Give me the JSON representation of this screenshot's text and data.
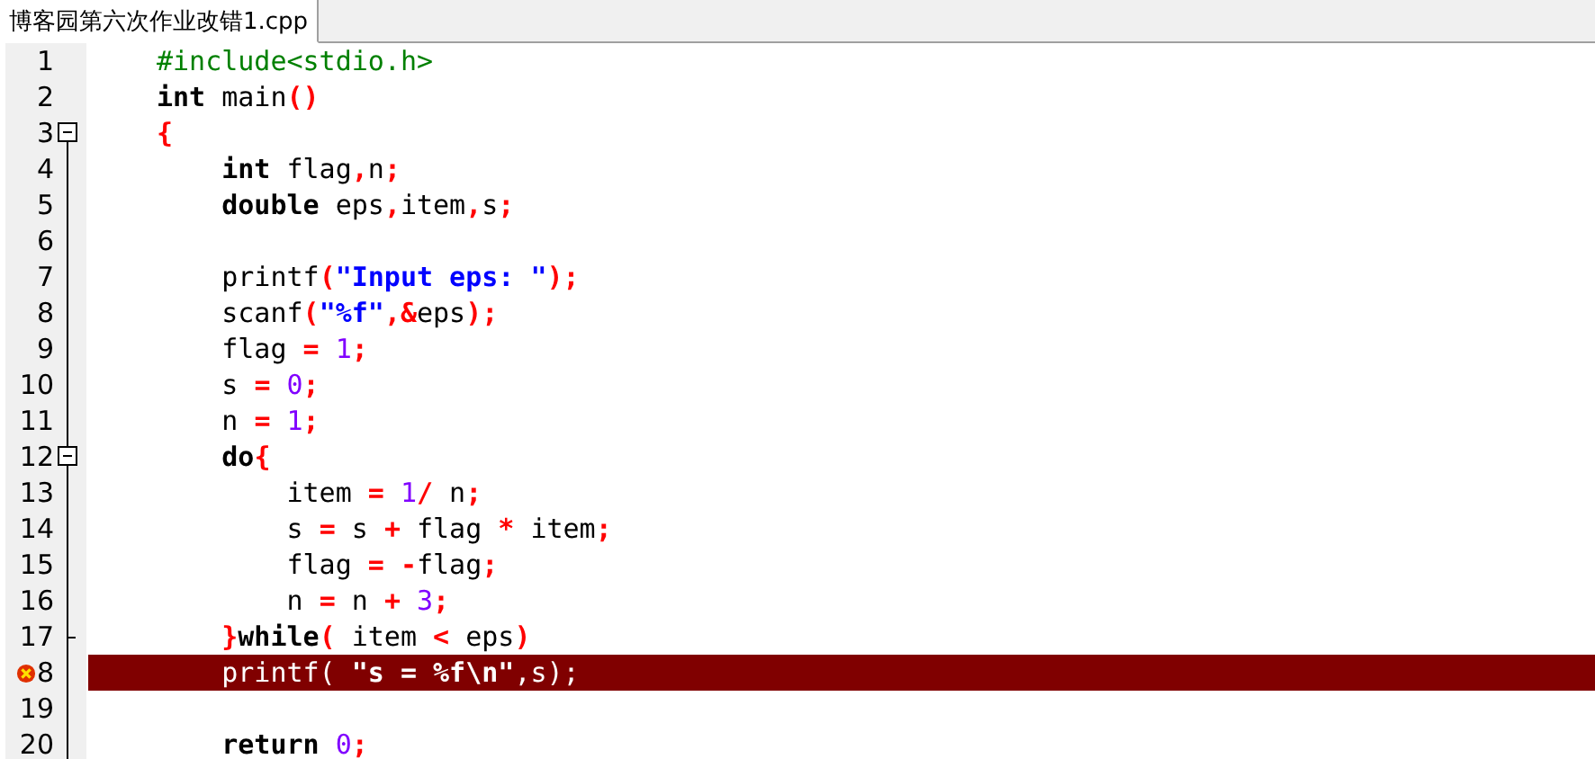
{
  "tabs": [
    {
      "label": "博客园第六次作业改错1.cpp",
      "selected": true
    }
  ],
  "lines": [
    {
      "number": "1",
      "tokens": [
        {
          "text": "#include<stdio.h>",
          "kind": "preproc"
        }
      ]
    },
    {
      "number": "2",
      "tokens": [
        {
          "text": "int",
          "kind": "keyword"
        },
        {
          "text": " main",
          "kind": "plain"
        },
        {
          "text": "()",
          "kind": "symbol"
        }
      ]
    },
    {
      "number": "3",
      "fold_start": true,
      "expanded": true,
      "tokens": [
        {
          "text": "{",
          "kind": "symbol"
        }
      ]
    },
    {
      "number": "4",
      "tokens": [
        {
          "text": "    int",
          "kind": "keyword"
        },
        {
          "text": " flag",
          "kind": "plain"
        },
        {
          "text": ",",
          "kind": "symbol"
        },
        {
          "text": "n",
          "kind": "plain"
        },
        {
          "text": ";",
          "kind": "symbol"
        }
      ]
    },
    {
      "number": "5",
      "tokens": [
        {
          "text": "    double",
          "kind": "keyword"
        },
        {
          "text": " eps",
          "kind": "plain"
        },
        {
          "text": ",",
          "kind": "symbol"
        },
        {
          "text": "item",
          "kind": "plain"
        },
        {
          "text": ",",
          "kind": "symbol"
        },
        {
          "text": "s",
          "kind": "plain"
        },
        {
          "text": ";",
          "kind": "symbol"
        }
      ]
    },
    {
      "number": "6"
    },
    {
      "number": "7",
      "tokens": [
        {
          "text": "    printf",
          "kind": "plain"
        },
        {
          "text": "(",
          "kind": "symbol"
        },
        {
          "text": "\"Input eps: \"",
          "kind": "string"
        },
        {
          "text": ");",
          "kind": "symbol"
        }
      ]
    },
    {
      "number": "8",
      "tokens": [
        {
          "text": "    scanf",
          "kind": "plain"
        },
        {
          "text": "(",
          "kind": "symbol"
        },
        {
          "text": "\"%f\"",
          "kind": "string"
        },
        {
          "text": ",&",
          "kind": "symbol"
        },
        {
          "text": "eps",
          "kind": "plain"
        },
        {
          "text": ");",
          "kind": "symbol"
        }
      ]
    },
    {
      "number": "9",
      "tokens": [
        {
          "text": "    flag ",
          "kind": "plain"
        },
        {
          "text": "=",
          "kind": "symbol"
        },
        {
          "text": " 1",
          "kind": "number"
        },
        {
          "text": ";",
          "kind": "symbol"
        }
      ]
    },
    {
      "number": "10",
      "tokens": [
        {
          "text": "    s ",
          "kind": "plain"
        },
        {
          "text": "=",
          "kind": "symbol"
        },
        {
          "text": " 0",
          "kind": "number"
        },
        {
          "text": ";",
          "kind": "symbol"
        }
      ]
    },
    {
      "number": "11",
      "tokens": [
        {
          "text": "    n ",
          "kind": "plain"
        },
        {
          "text": "=",
          "kind": "symbol"
        },
        {
          "text": " 1",
          "kind": "number"
        },
        {
          "text": ";",
          "kind": "symbol"
        }
      ]
    },
    {
      "number": "12",
      "fold_start": true,
      "expanded": true,
      "tokens": [
        {
          "text": "    do",
          "kind": "keyword"
        },
        {
          "text": "{",
          "kind": "symbol"
        }
      ]
    },
    {
      "number": "13",
      "tokens": [
        {
          "text": "        item ",
          "kind": "plain"
        },
        {
          "text": "=",
          "kind": "symbol"
        },
        {
          "text": " 1",
          "kind": "number"
        },
        {
          "text": "/",
          "kind": "symbol"
        },
        {
          "text": " n",
          "kind": "plain"
        },
        {
          "text": ";",
          "kind": "symbol"
        }
      ]
    },
    {
      "number": "14",
      "tokens": [
        {
          "text": "        s ",
          "kind": "plain"
        },
        {
          "text": "=",
          "kind": "symbol"
        },
        {
          "text": " s ",
          "kind": "plain"
        },
        {
          "text": "+",
          "kind": "symbol"
        },
        {
          "text": " flag ",
          "kind": "plain"
        },
        {
          "text": "*",
          "kind": "symbol"
        },
        {
          "text": " item",
          "kind": "plain"
        },
        {
          "text": ";",
          "kind": "symbol"
        }
      ]
    },
    {
      "number": "15",
      "tokens": [
        {
          "text": "        flag ",
          "kind": "plain"
        },
        {
          "text": "=",
          "kind": "symbol"
        },
        {
          "text": " -",
          "kind": "symbol"
        },
        {
          "text": "flag",
          "kind": "plain"
        },
        {
          "text": ";",
          "kind": "symbol"
        }
      ]
    },
    {
      "number": "16",
      "tokens": [
        {
          "text": "        n ",
          "kind": "plain"
        },
        {
          "text": "=",
          "kind": "symbol"
        },
        {
          "text": " n ",
          "kind": "plain"
        },
        {
          "text": "+",
          "kind": "symbol"
        },
        {
          "text": " 3",
          "kind": "number"
        },
        {
          "text": ";",
          "kind": "symbol"
        }
      ]
    },
    {
      "number": "17",
      "fold_end": true,
      "tokens": [
        {
          "text": "    }",
          "kind": "symbol"
        },
        {
          "text": "while",
          "kind": "keyword"
        },
        {
          "text": "(",
          "kind": "symbol"
        },
        {
          "text": " item ",
          "kind": "plain"
        },
        {
          "text": "<",
          "kind": "symbol"
        },
        {
          "text": " eps",
          "kind": "plain"
        },
        {
          "text": ")",
          "kind": "symbol"
        }
      ]
    },
    {
      "number": "8",
      "breakpoint": true,
      "highlighted": true,
      "tokens": [
        {
          "text": "    printf( ",
          "kind": "plain"
        },
        {
          "text": "\"s = %f\\n\"",
          "kind": "string"
        },
        {
          "text": ",s);",
          "kind": "plain"
        }
      ]
    },
    {
      "number": "19"
    },
    {
      "number": "20",
      "tokens": [
        {
          "text": "    return",
          "kind": "keyword"
        },
        {
          "text": " 0",
          "kind": "number"
        },
        {
          "text": ";",
          "kind": "symbol"
        }
      ]
    }
  ]
}
